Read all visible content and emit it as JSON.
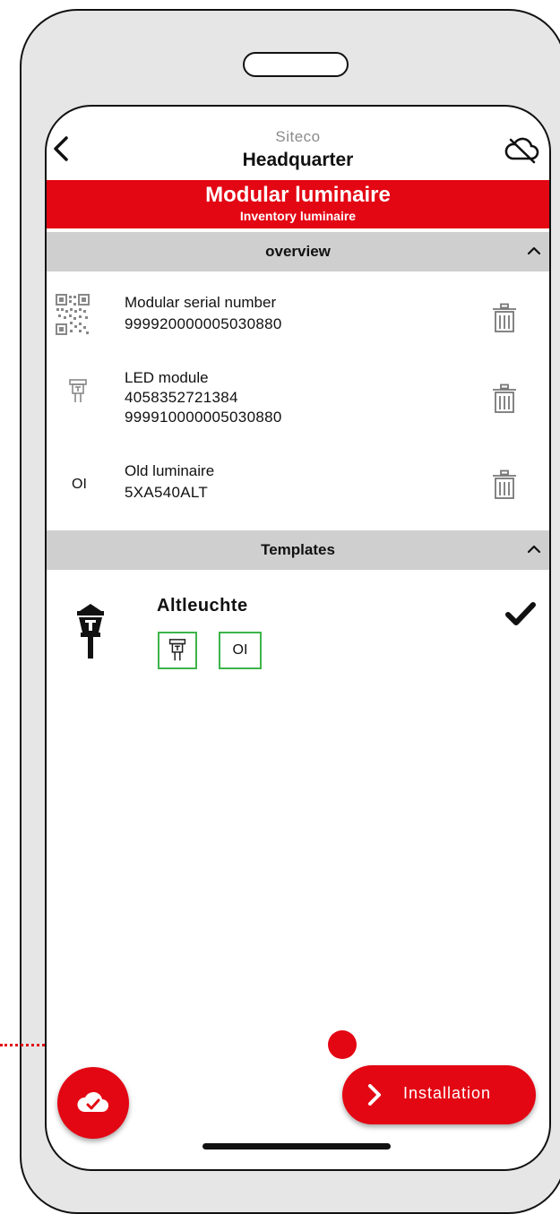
{
  "header": {
    "subtitle": "Siteco",
    "title": "Headquarter"
  },
  "banner": {
    "title": "Modular luminaire",
    "subtitle": "Inventory luminaire"
  },
  "overview": {
    "label": "overview",
    "items": [
      {
        "icon": "qr-code-icon",
        "label": "Modular serial number",
        "values": [
          "999920000005030880"
        ]
      },
      {
        "icon": "led-module-icon",
        "label": "LED module",
        "values": [
          "4058352721384",
          "999910000005030880"
        ]
      },
      {
        "icon": "old-luminaire-icon",
        "icon_text": "OI",
        "label": "Old luminaire",
        "values": [
          "5XA540ALT"
        ]
      }
    ]
  },
  "templates": {
    "label": "Templates",
    "items": [
      {
        "name": "Altleuchte",
        "selected": true,
        "box_text": "OI"
      }
    ]
  },
  "actions": {
    "install_label": "Installation"
  },
  "colors": {
    "brand_red": "#e30613",
    "section_gray": "#cfcfcf",
    "template_green": "#3db44a"
  }
}
